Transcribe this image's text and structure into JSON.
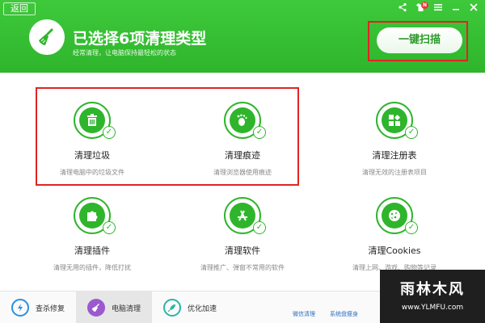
{
  "header": {
    "back_label": "返回",
    "title": "已选择6项清理类型",
    "subtitle": "经常清理，让电脑保持最轻松的状态",
    "scan_button": "一键扫描",
    "badge": "N"
  },
  "items": [
    {
      "title": "清理垃圾",
      "desc": "清理电脑中的垃圾文件",
      "icon": "trash-icon"
    },
    {
      "title": "清理痕迹",
      "desc": "清理浏览器使用痕迹",
      "icon": "footprint-icon"
    },
    {
      "title": "清理注册表",
      "desc": "清理无效的注册表项目",
      "icon": "registry-icon"
    },
    {
      "title": "清理插件",
      "desc": "清理无用的插件，降低打扰",
      "icon": "puzzle-icon"
    },
    {
      "title": "清理软件",
      "desc": "清理推广、弹窗不常用的软件",
      "icon": "app-store-icon"
    },
    {
      "title": "清理Cookies",
      "desc": "清理上网、游戏、购物等记录",
      "icon": "cookie-icon"
    }
  ],
  "bottom": {
    "tabs": [
      {
        "label": "查杀修复",
        "icon": "shield-bolt-icon"
      },
      {
        "label": "电脑清理",
        "icon": "broom-icon"
      },
      {
        "label": "优化加速",
        "icon": "rocket-icon"
      }
    ],
    "links": [
      "微信清理",
      "系统盘瘦身"
    ]
  },
  "watermark": {
    "text": "雨林木风",
    "url": "www.YLMFU.com"
  },
  "colors": {
    "brand_green": "#2fb52c",
    "highlight_red": "#e02424",
    "link_blue": "#2a6fc0"
  }
}
